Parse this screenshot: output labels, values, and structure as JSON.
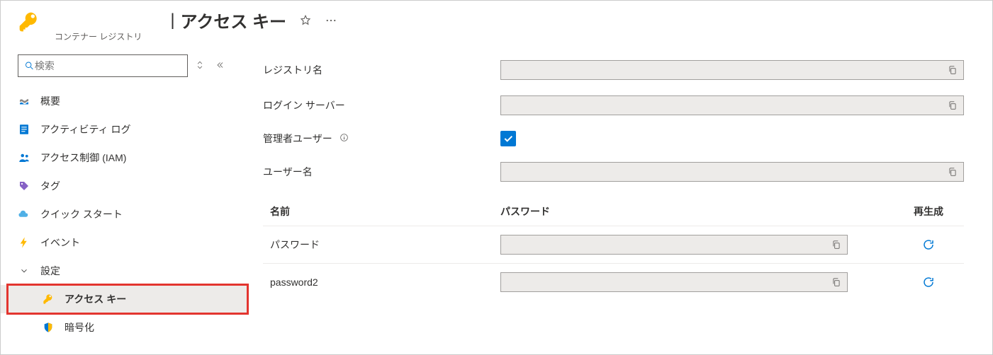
{
  "header": {
    "subtitle": "コンテナー レジストリ",
    "title": "アクセス キー"
  },
  "sidebar": {
    "search_placeholder": "検索",
    "items": [
      {
        "id": "overview",
        "label": "概要"
      },
      {
        "id": "activity-log",
        "label": "アクティビティ ログ"
      },
      {
        "id": "iam",
        "label": "アクセス制御 (IAM)"
      },
      {
        "id": "tags",
        "label": "タグ"
      },
      {
        "id": "quickstart",
        "label": "クイック スタート"
      },
      {
        "id": "events",
        "label": "イベント"
      }
    ],
    "section": {
      "label": "設定",
      "items": [
        {
          "id": "access-keys",
          "label": "アクセス キー",
          "active": true
        },
        {
          "id": "encryption",
          "label": "暗号化",
          "active": false
        }
      ]
    }
  },
  "fields": {
    "registry_name_label": "レジストリ名",
    "login_server_label": "ログイン サーバー",
    "admin_user_label": "管理者ユーザー",
    "admin_user_checked": true,
    "username_label": "ユーザー名"
  },
  "table": {
    "headers": {
      "name": "名前",
      "password": "パスワード",
      "regenerate": "再生成"
    },
    "rows": [
      {
        "name": "パスワード"
      },
      {
        "name": "password2"
      }
    ]
  }
}
